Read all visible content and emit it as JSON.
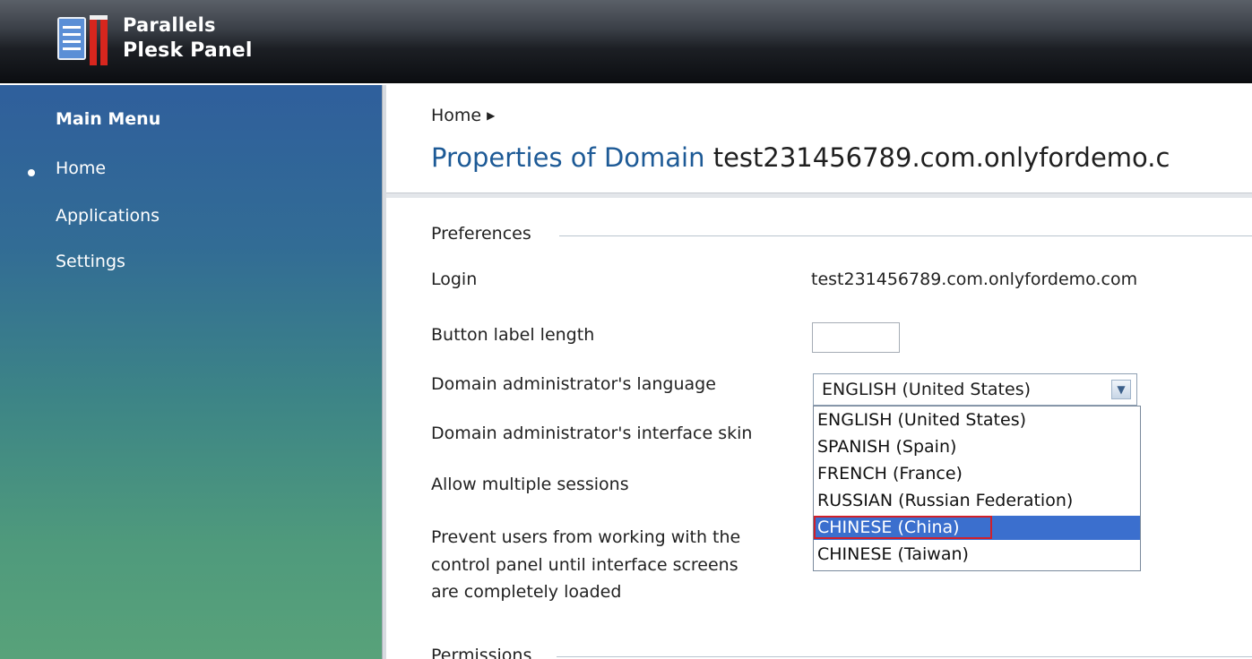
{
  "header": {
    "brand_line1": "Parallels",
    "brand_line2": "Plesk Panel"
  },
  "sidebar": {
    "title": "Main Menu",
    "items": [
      {
        "label": "Home",
        "active": true
      },
      {
        "label": "Applications",
        "active": false
      },
      {
        "label": "Settings",
        "active": false
      }
    ]
  },
  "breadcrumb": {
    "home": "Home"
  },
  "page": {
    "title_prefix": "Properties of Domain",
    "title_domain": "test231456789.com.onlyfordemo.c"
  },
  "preferences": {
    "section_label": "Preferences",
    "login_label": "Login",
    "login_value": "test231456789.com.onlyfordemo.com",
    "button_label_length_label": "Button label length",
    "button_label_length_value": "",
    "language_label": "Domain administrator's language",
    "language_selected": "ENGLISH (United States)",
    "skin_label": "Domain administrator's interface skin",
    "multiple_sessions_label": "Allow multiple sessions",
    "prevent_label_line1": "Prevent users from working with the",
    "prevent_label_line2": "control panel until interface screens",
    "prevent_label_line3": "are completely loaded"
  },
  "language_options": [
    "ENGLISH (United States)",
    "SPANISH (Spain)",
    "FRENCH (France)",
    "RUSSIAN (Russian Federation)",
    "CHINESE (China)",
    "CHINESE (Taiwan)"
  ],
  "highlighted_option": "CHINESE (China)",
  "permissions": {
    "section_label": "Permissions"
  },
  "colors": {
    "title_blue": "#1d5a96",
    "highlight_blue": "#3b6fce",
    "highlight_outline_red": "#d0202a"
  }
}
